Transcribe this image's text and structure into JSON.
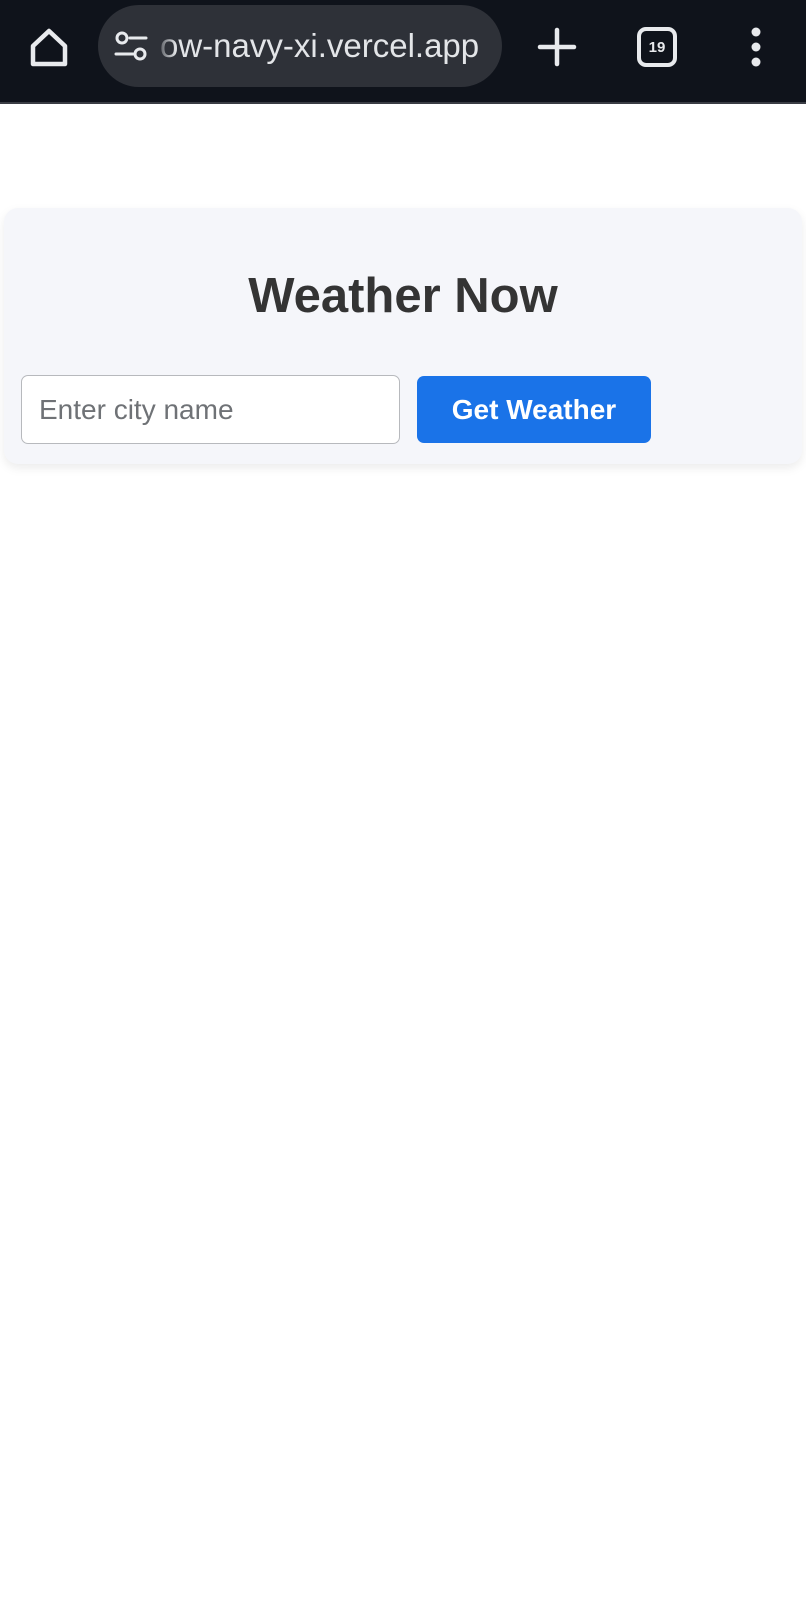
{
  "browser": {
    "url_visible": "ow-navy-xi.vercel.app",
    "tab_count": "19",
    "icons": {
      "home": "home-icon",
      "site_settings": "tune-icon",
      "new_tab": "plus-icon",
      "menu": "more-vert-icon"
    }
  },
  "app": {
    "title": "Weather Now",
    "city_input": {
      "placeholder": "Enter city name",
      "value": ""
    },
    "submit_label": "Get Weather"
  },
  "colors": {
    "chrome_bg": "#0f131b",
    "url_pill_bg": "#2e3138",
    "card_bg": "#f5f6fa",
    "accent": "#1a73e8",
    "title_text": "#343434"
  }
}
